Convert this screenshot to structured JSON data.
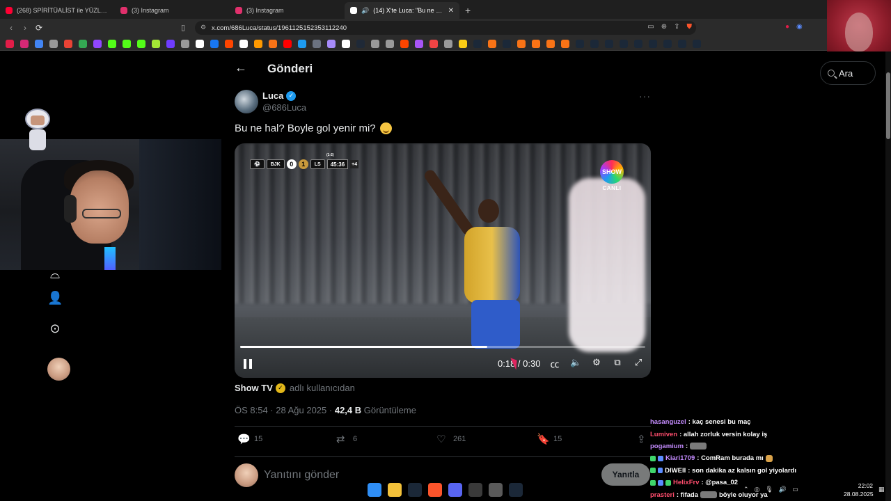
{
  "browser": {
    "tabs": [
      {
        "label": "(268) SPİRİTÜALİST ile YÜZLEŞME \"Bu",
        "color": "#ff0033",
        "active": false
      },
      {
        "label": "(3) Instagram",
        "color": "#e1306c",
        "active": false
      },
      {
        "label": "(3) Instagram",
        "color": "#e1306c",
        "active": false
      },
      {
        "label": "(14) X'te Luca: \"Bu ne hal? Bo",
        "color": "#ffffff",
        "active": true
      }
    ],
    "new_tab": "+",
    "url": "x.com/686Luca/status/1961125152353112240",
    "bookmark_colors": [
      "#e11d48",
      "#d62976",
      "#4285f4",
      "#9a9a9a",
      "#ea4335",
      "#34a853",
      "#9146ff",
      "#53fc18",
      "#53fc18",
      "#53fc18",
      "#a3e635",
      "#6f3cff",
      "#9a9a9a",
      "#ffffff",
      "#1877f2",
      "#ff4500",
      "#ffffff",
      "#ff9900",
      "#f97316",
      "#ff0000",
      "#1d9bf0",
      "#6b7280",
      "#a78bfa",
      "#ffffff",
      "#1f2937",
      "#9a9a9a",
      "#9a9a9a",
      "#ff4500",
      "#a855f7",
      "#ef4444",
      "#9a9a9a",
      "#facc15",
      "#1b2838",
      "#f97316",
      "#1b2838",
      "#f97316",
      "#f97316",
      "#f97316",
      "#f97316",
      "#1b2838",
      "#1b2838",
      "#1b2838",
      "#1b2838",
      "#1b2838",
      "#1b2838",
      "#1b2838",
      "#1b2838",
      "#1b2838"
    ]
  },
  "page": {
    "header_title": "Gönderi",
    "search_label": "Ara"
  },
  "tweet": {
    "author_name": "Luca",
    "author_handle": "@686Luca",
    "text": "Bu ne hal? Boyle gol yenir mi?",
    "from_name": "Show TV",
    "from_suffix": "adlı kullanıcıdan",
    "timestamp": "ÖS 8:54 · 28 Ağu 2025 ·",
    "views_count": "42,4 B",
    "views_label": "Görüntüleme",
    "replies": "15",
    "reposts": "6",
    "likes": "261",
    "bookmarks": "15",
    "reply_placeholder": "Yanıtını gönder",
    "reply_button": "Yanıtla"
  },
  "video": {
    "team_home": "BJK",
    "score_home": "0",
    "score_away": "1",
    "team_away": "LS",
    "match_clock": "45:36",
    "aggregate": "(1-2)",
    "added_time": "+4",
    "channel_logo": "SHOW",
    "channel_live": "CANLI",
    "current_time": "0:18",
    "duration": "0:30",
    "progress": 0.61
  },
  "chat": [
    {
      "user": "hasanguzel",
      "color": "#c58cff",
      "msg": " : kaç senesi bu maç",
      "badges": 0,
      "emote": ""
    },
    {
      "user": "Lumiven",
      "color": "#ff4d6d",
      "msg": " : allah zorluk versin kolay iş",
      "badges": 0,
      "emote": ""
    },
    {
      "user": "pogamium",
      "color": "#c58cff",
      "msg": " :",
      "badges": 0,
      "emote": "wide"
    },
    {
      "user": "Kiari1709",
      "color": "#c58cff",
      "msg": " : ComRam burada mı",
      "badges": 2,
      "emote": "small"
    },
    {
      "user": "DIWEII",
      "color": "#ffffff",
      "msg": " : son dakika az kalsın gol yiyolardı",
      "badges": 2,
      "emote": ""
    },
    {
      "user": "HelixFrv",
      "color": "#ff4d6d",
      "msg": " : @pasa_02",
      "badges": 3,
      "emote": ""
    },
    {
      "user": "prasteri",
      "color": "#ff4d6d",
      "msg": " : fifada",
      "badges": 0,
      "emote": "wide",
      "tail": "böyle oluyor ya"
    }
  ],
  "taskbar": {
    "icons": [
      "#2f8ef5",
      "#f3c13a",
      "#1b2838",
      "#fb542b",
      "#5865f2",
      "#3a3a3a",
      "#5a5a5a",
      "#1b2838"
    ],
    "time": "22:02",
    "date": "28.08.2025"
  }
}
